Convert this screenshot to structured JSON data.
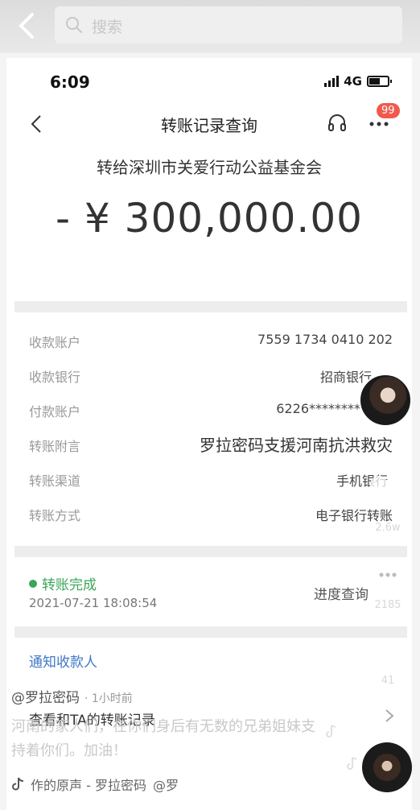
{
  "outer": {
    "search_placeholder": "搜索"
  },
  "status_bar": {
    "time": "6:09",
    "network": "4G"
  },
  "nav": {
    "title": "转账记录查询",
    "badge": "99"
  },
  "transfer": {
    "recipient": "转给深圳市关爱行动公益基金会",
    "amount": "- ¥ 300,000.00"
  },
  "details": [
    {
      "label": "收款账户",
      "value": "7559 1734 0410 202"
    },
    {
      "label": "收款银行",
      "value": "招商银行"
    },
    {
      "label": "付款账户",
      "value": "6226********"
    },
    {
      "label": "转账附言",
      "value": "罗拉密码支援河南抗洪救灾"
    },
    {
      "label": "转账渠道",
      "value": "手机银行"
    },
    {
      "label": "转账方式",
      "value": "电子银行转账"
    }
  ],
  "status": {
    "label": "转账完成",
    "datetime": "2021-07-21 18:08:54",
    "progress_link": "进度查询"
  },
  "links": {
    "notify": "通知收款人",
    "check": "查看和TA的转账记录"
  },
  "video": {
    "likes": "2.6w",
    "comments": "2185",
    "shares": "41",
    "author": "@罗拉密码",
    "author_time": "· 1小时前",
    "caption": "河南的家人们，在你们身后有无数的兄弟姐妹支持着你们。加油！",
    "music": "作的原声 - 罗拉密码",
    "music_at": "@罗"
  },
  "colors": {
    "success": "#3aa757",
    "link": "#3f78c7",
    "badge": "#f05a4c"
  }
}
